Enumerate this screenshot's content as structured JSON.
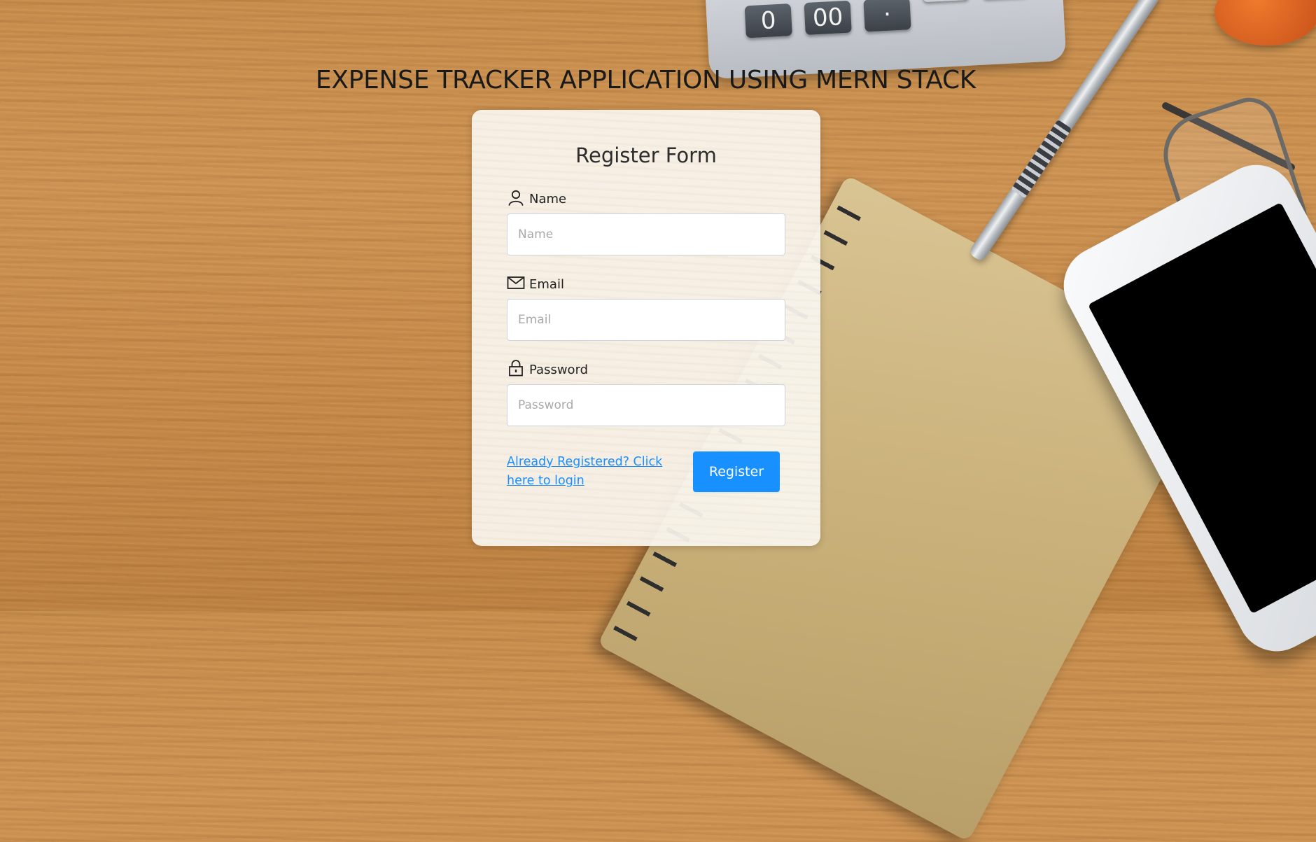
{
  "page": {
    "title": "EXPENSE TRACKER APPLICATION USING MERN STACK"
  },
  "form": {
    "title": "Register Form",
    "fields": [
      {
        "icon": "user-icon",
        "label": "Name",
        "placeholder": "Name",
        "value": ""
      },
      {
        "icon": "mail-icon",
        "label": "Email",
        "placeholder": "Email",
        "value": ""
      },
      {
        "icon": "lock-icon",
        "label": "Password",
        "placeholder": "Password",
        "value": ""
      }
    ],
    "login_link": "Already Registered? Click here to login",
    "submit_label": "Register"
  },
  "background": {
    "calculator_keys": [
      "0",
      "00",
      "·"
    ]
  },
  "colors": {
    "accent": "#1890ff",
    "link": "#1890ff",
    "card_bg": "#faf6f0",
    "title_text": "#1a1a1a"
  }
}
